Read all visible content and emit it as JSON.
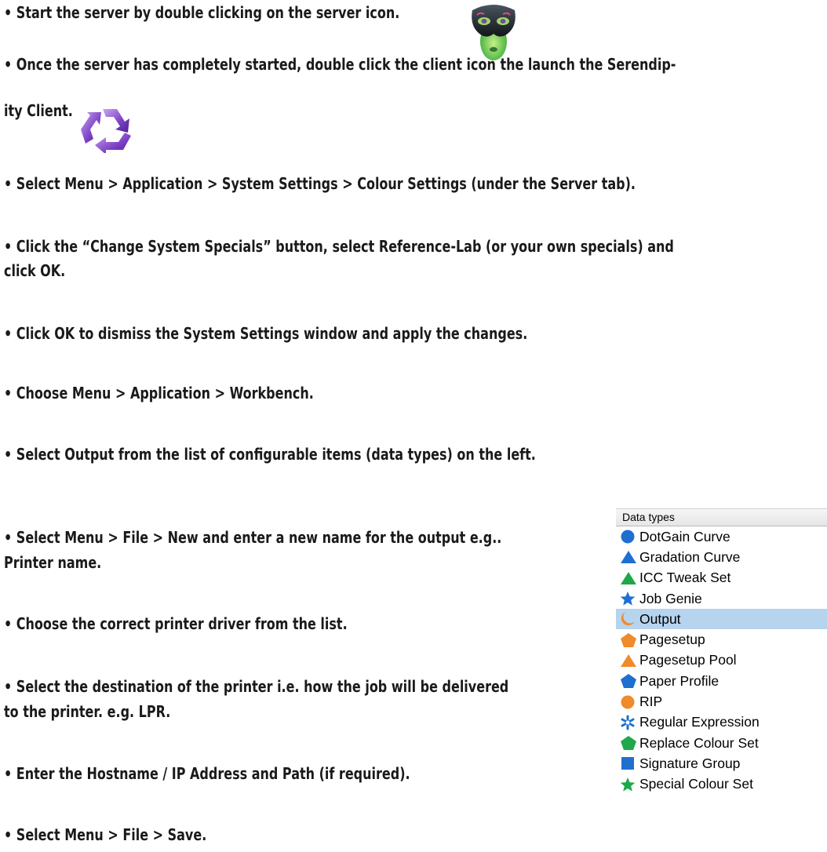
{
  "instructions": [
    {
      "id": "start-server",
      "lines": [
        "• Start the server by double clicking on the server icon."
      ]
    },
    {
      "id": "launch-client",
      "lines": [
        "• Once the server has completely started, double click the client icon the launch the Serendip-",
        "ity Client."
      ]
    },
    {
      "id": "colour-settings",
      "lines": [
        "• Select Menu > Application > System Settings > Colour Settings (under the Server tab)."
      ]
    },
    {
      "id": "change-specials",
      "lines": [
        "• Click the “Change System Specials” button, select Reference-Lab (or your own specials) and",
        "click OK."
      ]
    },
    {
      "id": "dismiss-settings",
      "lines": [
        "• Click OK to dismiss the System Settings window and apply the changes."
      ]
    },
    {
      "id": "workbench",
      "lines": [
        "• Choose Menu > Application > Workbench."
      ]
    },
    {
      "id": "select-output",
      "lines": [
        "• Select Output from the list of configurable items (data types) on the left."
      ]
    },
    {
      "id": "new-output",
      "lines": [
        "• Select Menu > File > New and enter a new name for the output e.g..",
        "Printer name."
      ]
    },
    {
      "id": "printer-driver",
      "lines": [
        "• Choose the correct printer driver from the list."
      ]
    },
    {
      "id": "destination",
      "lines": [
        "• Select the destination of the printer i.e. how the job will be delivered",
        "to the printer. e.g. LPR."
      ]
    },
    {
      "id": "hostname",
      "lines": [
        "• Enter the Hostname / IP Address and Path (if required)."
      ]
    },
    {
      "id": "save",
      "lines": [
        "• Select Menu > File > Save."
      ]
    }
  ],
  "data_types_panel": {
    "header": "Data types",
    "items": [
      {
        "label": "DotGain Curve",
        "icon": "blue-circle-icon",
        "color": "#1f6fd1",
        "selected": false
      },
      {
        "label": "Gradation Curve",
        "icon": "blue-triangle-icon",
        "color": "#1f6fd1",
        "selected": false
      },
      {
        "label": "ICC Tweak Set",
        "icon": "green-triangle-icon",
        "color": "#1ea84a",
        "selected": false
      },
      {
        "label": "Job Genie",
        "icon": "blue-star-icon",
        "color": "#1f6fd1",
        "selected": false
      },
      {
        "label": "Output",
        "icon": "orange-crescent-icon",
        "color": "#f08a2a",
        "selected": true
      },
      {
        "label": "Pagesetup",
        "icon": "orange-pentagon-icon",
        "color": "#f08a2a",
        "selected": false
      },
      {
        "label": "Pagesetup Pool",
        "icon": "orange-triangle-icon",
        "color": "#f08a2a",
        "selected": false
      },
      {
        "label": "Paper Profile",
        "icon": "blue-pentagon-icon",
        "color": "#1f6fd1",
        "selected": false
      },
      {
        "label": "RIP",
        "icon": "orange-circle-icon",
        "color": "#f08a2a",
        "selected": false
      },
      {
        "label": "Regular Expression",
        "icon": "blue-asterisk-icon",
        "color": "#1f6fd1",
        "selected": false
      },
      {
        "label": "Replace Colour Set",
        "icon": "green-pentagon-icon",
        "color": "#1ea84a",
        "selected": false
      },
      {
        "label": "Signature Group",
        "icon": "blue-square-icon",
        "color": "#1f6fd1",
        "selected": false
      },
      {
        "label": "Special Colour Set",
        "icon": "green-star-icon",
        "color": "#1ea84a",
        "selected": false
      }
    ]
  },
  "icons": {
    "server": "server-mask-icon",
    "client": "client-arrows-icon"
  }
}
